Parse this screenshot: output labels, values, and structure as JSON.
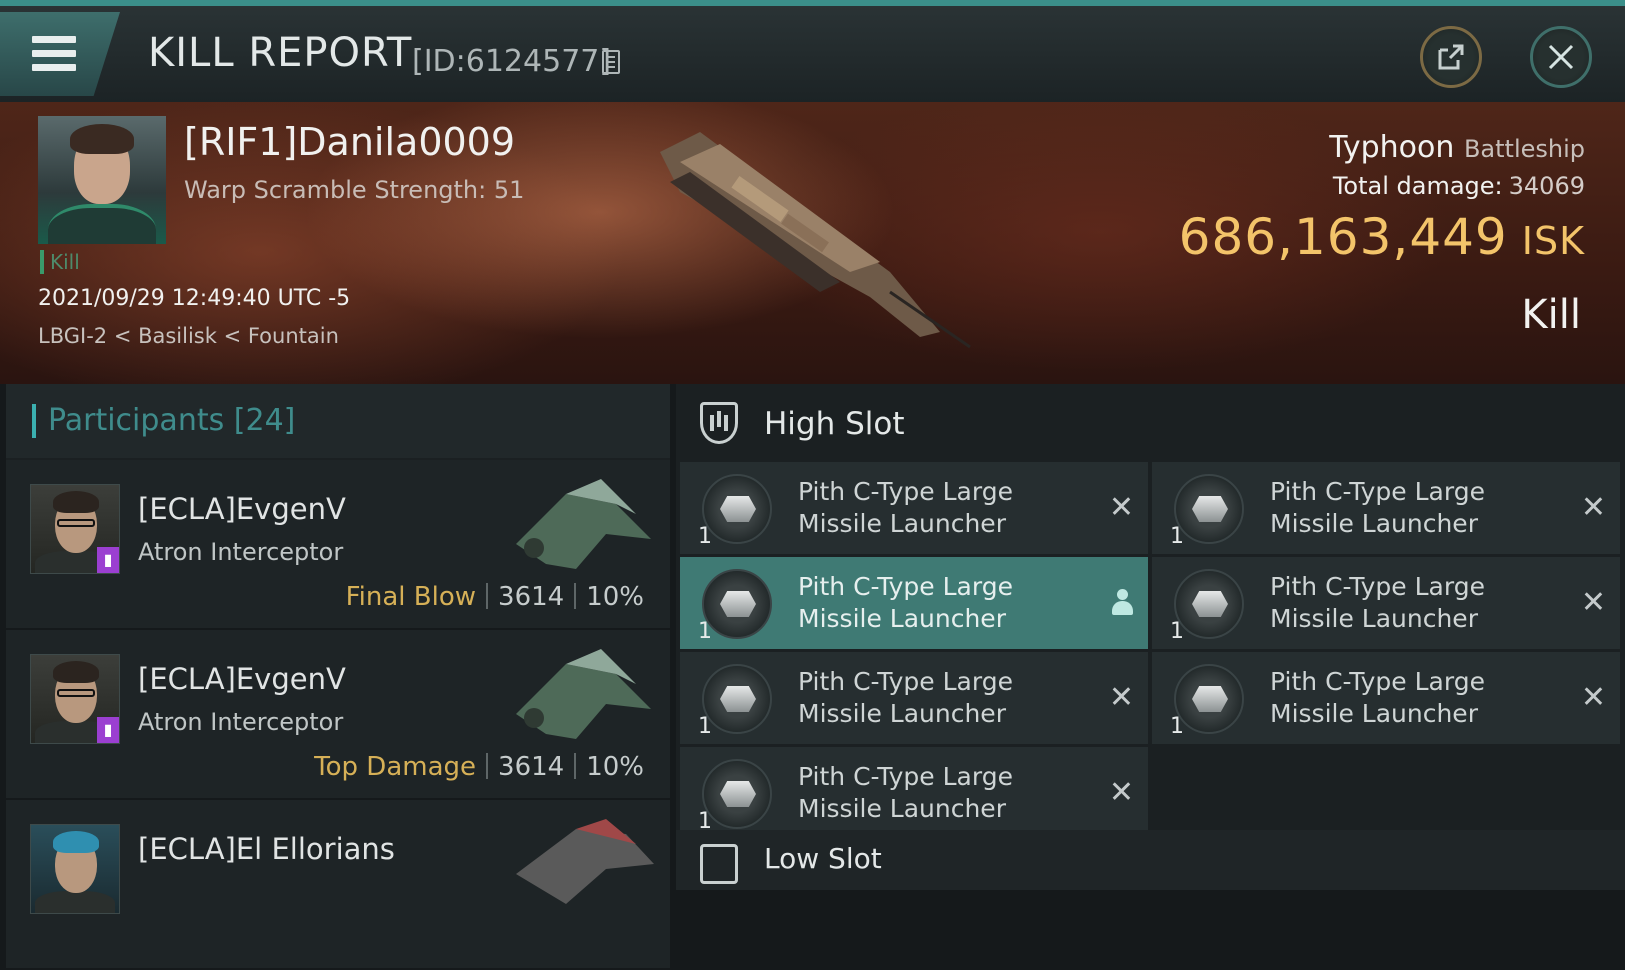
{
  "header": {
    "title": "KILL REPORT",
    "report_id": "[ID:6124577]",
    "icons": [
      "menu-icon",
      "copy-icon",
      "share-icon",
      "close-icon"
    ]
  },
  "victim": {
    "name": "[RIF1]Danila0009",
    "warp_scramble": "Warp Scramble Strength: 51",
    "kill_label": "Kill",
    "datetime": "2021/09/29 12:49:40 UTC -5",
    "location": "LBGI-2 < Basilisk < Fountain",
    "ship_name": "Typhoon",
    "ship_class": "Battleship",
    "total_damage_label": "Total damage:",
    "total_damage": "34069",
    "isk_value": "686,163,449",
    "isk_unit": "ISK",
    "result": "Kill"
  },
  "participants": {
    "title": "Participants",
    "count": "[24]",
    "items": [
      {
        "name": "[ECLA]EvgenV",
        "ship": "Atron Interceptor",
        "role": "Final Blow",
        "damage": "3614",
        "percent": "10%"
      },
      {
        "name": "[ECLA]EvgenV",
        "ship": "Atron Interceptor",
        "role": "Top Damage",
        "damage": "3614",
        "percent": "10%"
      },
      {
        "name": "[ECLA]El Ellorians",
        "ship": "",
        "role": "",
        "damage": "",
        "percent": ""
      }
    ]
  },
  "high_slot": {
    "title": "High Slot",
    "modules": [
      {
        "name": "Pith C-Type Large Missile Launcher",
        "qty": "1",
        "state": "destroyed"
      },
      {
        "name": "Pith C-Type Large Missile Launcher",
        "qty": "1",
        "state": "destroyed"
      },
      {
        "name": "Pith C-Type Large Missile Launcher",
        "qty": "1",
        "state": "dropped"
      },
      {
        "name": "Pith C-Type Large Missile Launcher",
        "qty": "1",
        "state": "destroyed"
      },
      {
        "name": "Pith C-Type Large Missile Launcher",
        "qty": "1",
        "state": "destroyed"
      },
      {
        "name": "Pith C-Type Large Missile Launcher",
        "qty": "1",
        "state": "destroyed"
      },
      {
        "name": "Pith C-Type Large Missile Launcher",
        "qty": "1",
        "state": "destroyed"
      }
    ]
  },
  "low_slot": {
    "title": "Low Slot"
  },
  "colors": {
    "accent": "#3bb0b0",
    "isk": "#f3c46a",
    "role": "#d6b057",
    "active_module": "#3f7a74"
  }
}
